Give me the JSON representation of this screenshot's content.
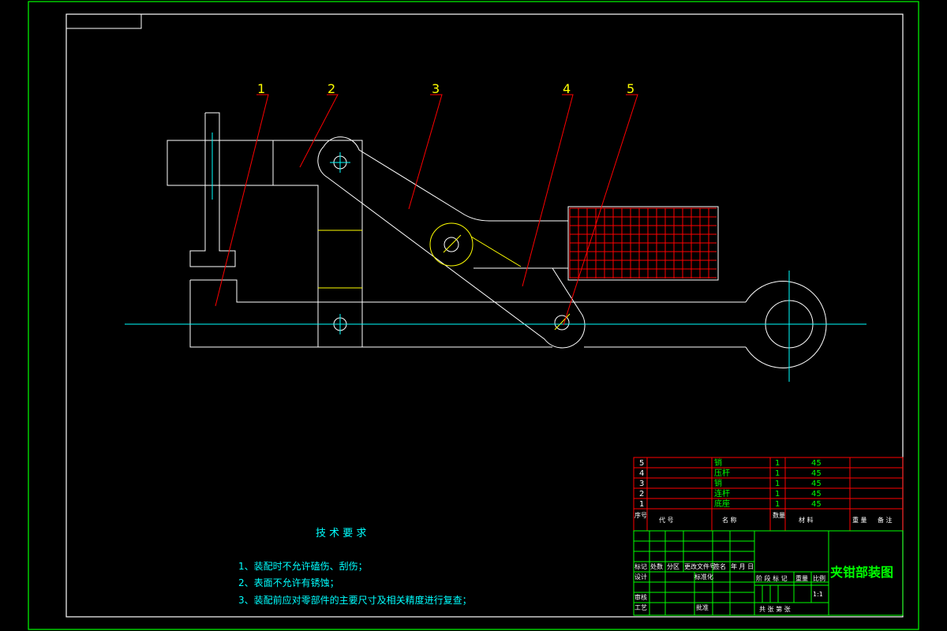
{
  "drawing": {
    "title": "夹钳部装图",
    "scale": "1:1",
    "balloons": [
      "1",
      "2",
      "3",
      "4",
      "5"
    ]
  },
  "tech_requirements": {
    "heading": "技 术 要 求",
    "items": [
      "1、装配时不允许磕伤、刮伤；",
      "2、表面不允许有锈蚀；",
      "3、装配前应对零部件的主要尺寸及相关精度进行复查；"
    ]
  },
  "bom": {
    "rows": [
      {
        "no": "5",
        "name": "销",
        "qty": "1",
        "material": "45"
      },
      {
        "no": "4",
        "name": "压杆",
        "qty": "1",
        "material": "45"
      },
      {
        "no": "3",
        "name": "销",
        "qty": "1",
        "material": "45"
      },
      {
        "no": "2",
        "name": "连杆",
        "qty": "1",
        "material": "45"
      },
      {
        "no": "1",
        "name": "底座",
        "qty": "1",
        "material": "45"
      }
    ],
    "header": {
      "no": "序号",
      "code": "代 号",
      "name": "名 称",
      "qty": "数量",
      "material": "材 料",
      "weight": "重 量",
      "remark": "备 注"
    }
  },
  "title_block": {
    "row_labels": [
      "标记",
      "处数",
      "分区",
      "更改文件号",
      "签名",
      "年 月 日"
    ],
    "design": "设计",
    "std": "标准化",
    "review": "审核",
    "process": "工艺",
    "approve": "批准",
    "stage_label": "阶 段 标 记",
    "weight_label": "重量",
    "scale_label": "比例",
    "sheets": "共    张  第    张"
  },
  "colors": {
    "border": "#00ff00",
    "part": "#ffffff",
    "center": "#00ffff",
    "leader": "#ff0000",
    "balloon": "#ffff00",
    "hatch": "#ff0000",
    "title": "#00ff00",
    "table": "#ff0000"
  }
}
